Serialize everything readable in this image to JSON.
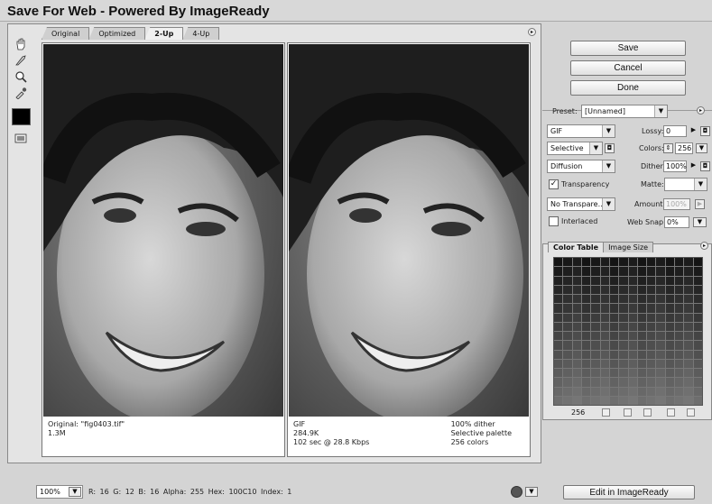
{
  "window": {
    "title": "Save For Web - Powered By ImageReady"
  },
  "tabs": [
    "Original",
    "Optimized",
    "2-Up",
    "4-Up"
  ],
  "active_tab": "2-Up",
  "tools": [
    "hand-icon",
    "slice-select-icon",
    "zoom-icon",
    "eyedropper-icon",
    "eyedropper-color-swatch",
    "toggle-slices-icon"
  ],
  "eyedropper_color": "#000000",
  "panes": {
    "original": {
      "line1": "Original: \"fig0403.tif\"",
      "line2": "1.3M"
    },
    "optimized": {
      "left": [
        "GIF",
        "284.9K",
        "102 sec @ 28.8 Kbps"
      ],
      "right": [
        "100% dither",
        "Selective palette",
        "256 colors"
      ]
    }
  },
  "buttons": {
    "save": "Save",
    "cancel": "Cancel",
    "done": "Done",
    "edit_imageready": "Edit in ImageReady"
  },
  "settings": {
    "preset_label": "Preset:",
    "preset_value": "[Unnamed]",
    "format": "GIF",
    "lossy_label": "Lossy:",
    "lossy_value": "0",
    "palette": "Selective",
    "colors_label": "Colors:",
    "colors_value": "256",
    "dither_algo": "Diffusion",
    "dither_label": "Dither:",
    "dither_value": "100%",
    "transparency_label": "Transparency",
    "transparency_checked": true,
    "matte_label": "Matte:",
    "matte_value": "",
    "transparency_dither": "No Transpare...",
    "amount_label": "Amount:",
    "amount_value": "100%",
    "interlaced_label": "Interlaced",
    "interlaced_checked": false,
    "websnap_label": "Web Snap:",
    "websnap_value": "0%"
  },
  "color_table": {
    "tabs": [
      "Color Table",
      "Image Size"
    ],
    "count": "256"
  },
  "status": {
    "zoom": "100%",
    "readout": "R:  16  G:  12  B:  16  Alpha: 255  Hex:   100C10  Index:   1"
  }
}
